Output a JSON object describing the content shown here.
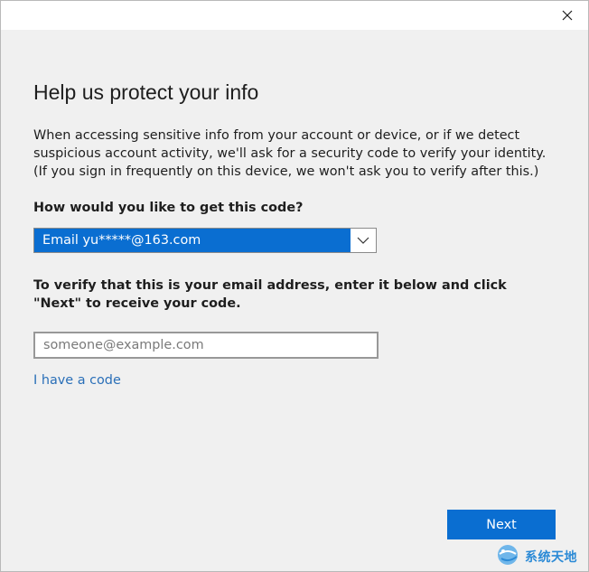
{
  "window": {
    "close_label": "Close"
  },
  "page": {
    "title": "Help us protect your info",
    "description": "When accessing sensitive info from your account or device, or if we detect suspicious account activity, we'll ask for a security code to verify your identity. (If you sign in frequently on this device, we won't ask you to verify after this.)",
    "question": "How would you like to get this code?",
    "method_select": {
      "selected": "Email yu*****@163.com"
    },
    "verify_instruction": "To verify that this is your email address, enter it below and click \"Next\" to receive your code.",
    "email_input": {
      "value": "",
      "placeholder": "someone@example.com"
    },
    "have_code_link": "I have a code",
    "next_button": "Next"
  },
  "watermark": {
    "text": "系统天地"
  },
  "colors": {
    "accent": "#0a6ed1",
    "link": "#2a6fb8",
    "background": "#f0f0f0"
  },
  "icons": {
    "close": "close-icon",
    "dropdown": "chevron-down-icon",
    "watermark_logo": "globe-logo-icon"
  }
}
